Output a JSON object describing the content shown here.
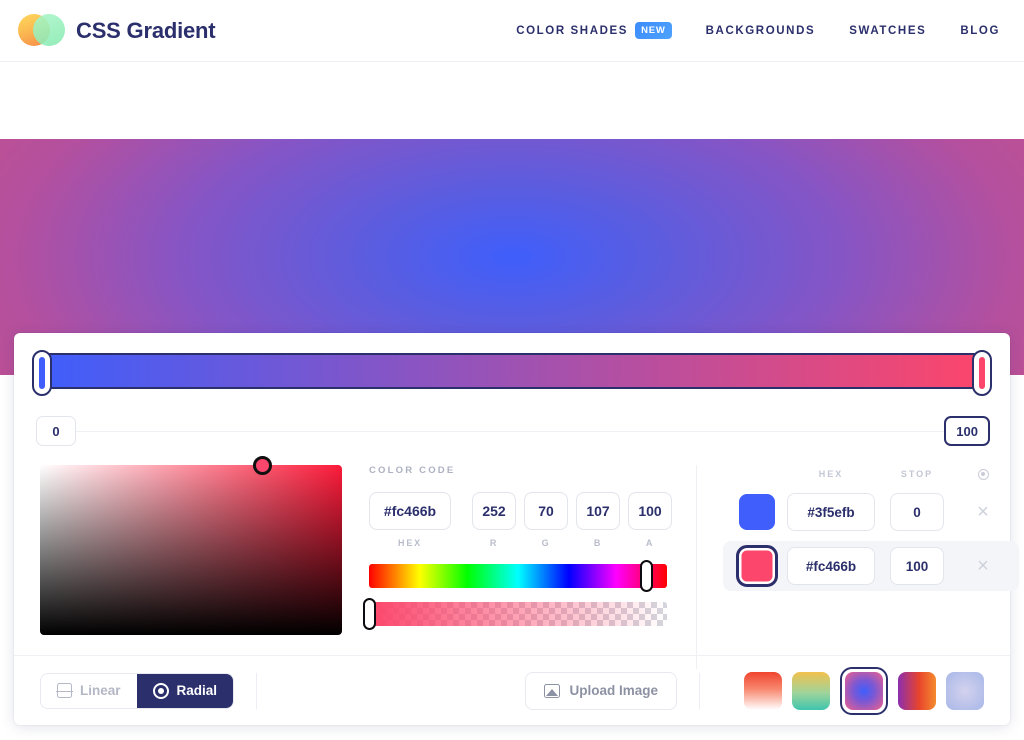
{
  "header": {
    "brand": "CSS Gradient",
    "logo_icon": "two-circles-logo",
    "nav": [
      {
        "label": "Color Shades",
        "badge": "NEW",
        "name": "color-shades"
      },
      {
        "label": "Backgrounds",
        "badge": "",
        "name": "backgrounds"
      },
      {
        "label": "Swatches",
        "badge": "",
        "name": "swatches"
      },
      {
        "label": "Blog",
        "badge": "",
        "name": "blog"
      }
    ]
  },
  "hero": {
    "gradient_type": "radial",
    "center_color": "#3f5efb",
    "edge_color": "#c24f8e"
  },
  "editor": {
    "preview": {
      "from_color": "#3f5efb",
      "to_color": "#fc466b",
      "handle_left_name": "gradient-handle-start",
      "handle_right_name": "gradient-handle-end"
    },
    "stop_positions": {
      "start": "0",
      "end": "100"
    },
    "picker": {
      "section_label": "Color Code",
      "base_hue_color": "#fc1b3a",
      "cursor_color": "#fc466b",
      "hex": {
        "value": "#fc466b",
        "sub": "HEX"
      },
      "r": {
        "value": "252",
        "sub": "R"
      },
      "g": {
        "value": "70",
        "sub": "G"
      },
      "b": {
        "value": "107",
        "sub": "B"
      },
      "a": {
        "value": "100",
        "sub": "A"
      },
      "hue_handle_pos": "93%",
      "alpha_handle_pos": "0%"
    },
    "stop_list": {
      "headers": {
        "swatch": "",
        "hex": "HEX",
        "stop": "STOP",
        "actions": "add-stop-icon"
      },
      "rows": [
        {
          "color": "#3f5efb",
          "hex": "#3f5efb",
          "stop": "0",
          "selected": false,
          "delete_icon": "×"
        },
        {
          "color": "#fc466b",
          "hex": "#fc466b",
          "stop": "100",
          "selected": true,
          "delete_icon": "×"
        }
      ]
    }
  },
  "toolbar": {
    "linear_label": "Linear",
    "radial_label": "Radial",
    "active_type": "Radial",
    "linear_icon": "linear-gradient-icon",
    "radial_icon": "radial-gradient-icon",
    "upload_label": "Upload Image",
    "upload_icon": "image-icon",
    "presets": [
      {
        "name": "preset-red-white",
        "css": "linear-gradient(to bottom, #f0452f 0%, #f8876f 45%, #ffffff 100%)",
        "active": false
      },
      {
        "name": "preset-yellow-teal",
        "css": "linear-gradient(to bottom, #f2c14e 0%, #9ed49a 55%, #3fc5ae 100%)",
        "active": false
      },
      {
        "name": "preset-blue-pink-radial",
        "css": "radial-gradient(circle at 50% 50%, #3f5efb 0%, #7b58d4 40%, #f0608b 100%)",
        "active": true
      },
      {
        "name": "preset-purple-orange",
        "css": "linear-gradient(to right, #8b2fb0 0%, #e8442c 55%, #f58a2e 100%)",
        "active": false
      },
      {
        "name": "preset-lavender-radial",
        "css": "radial-gradient(circle at 50% 50%, #d4d2ee 0%, #b9c2ea 60%, #a8b8e8 100%)",
        "active": false
      }
    ]
  }
}
